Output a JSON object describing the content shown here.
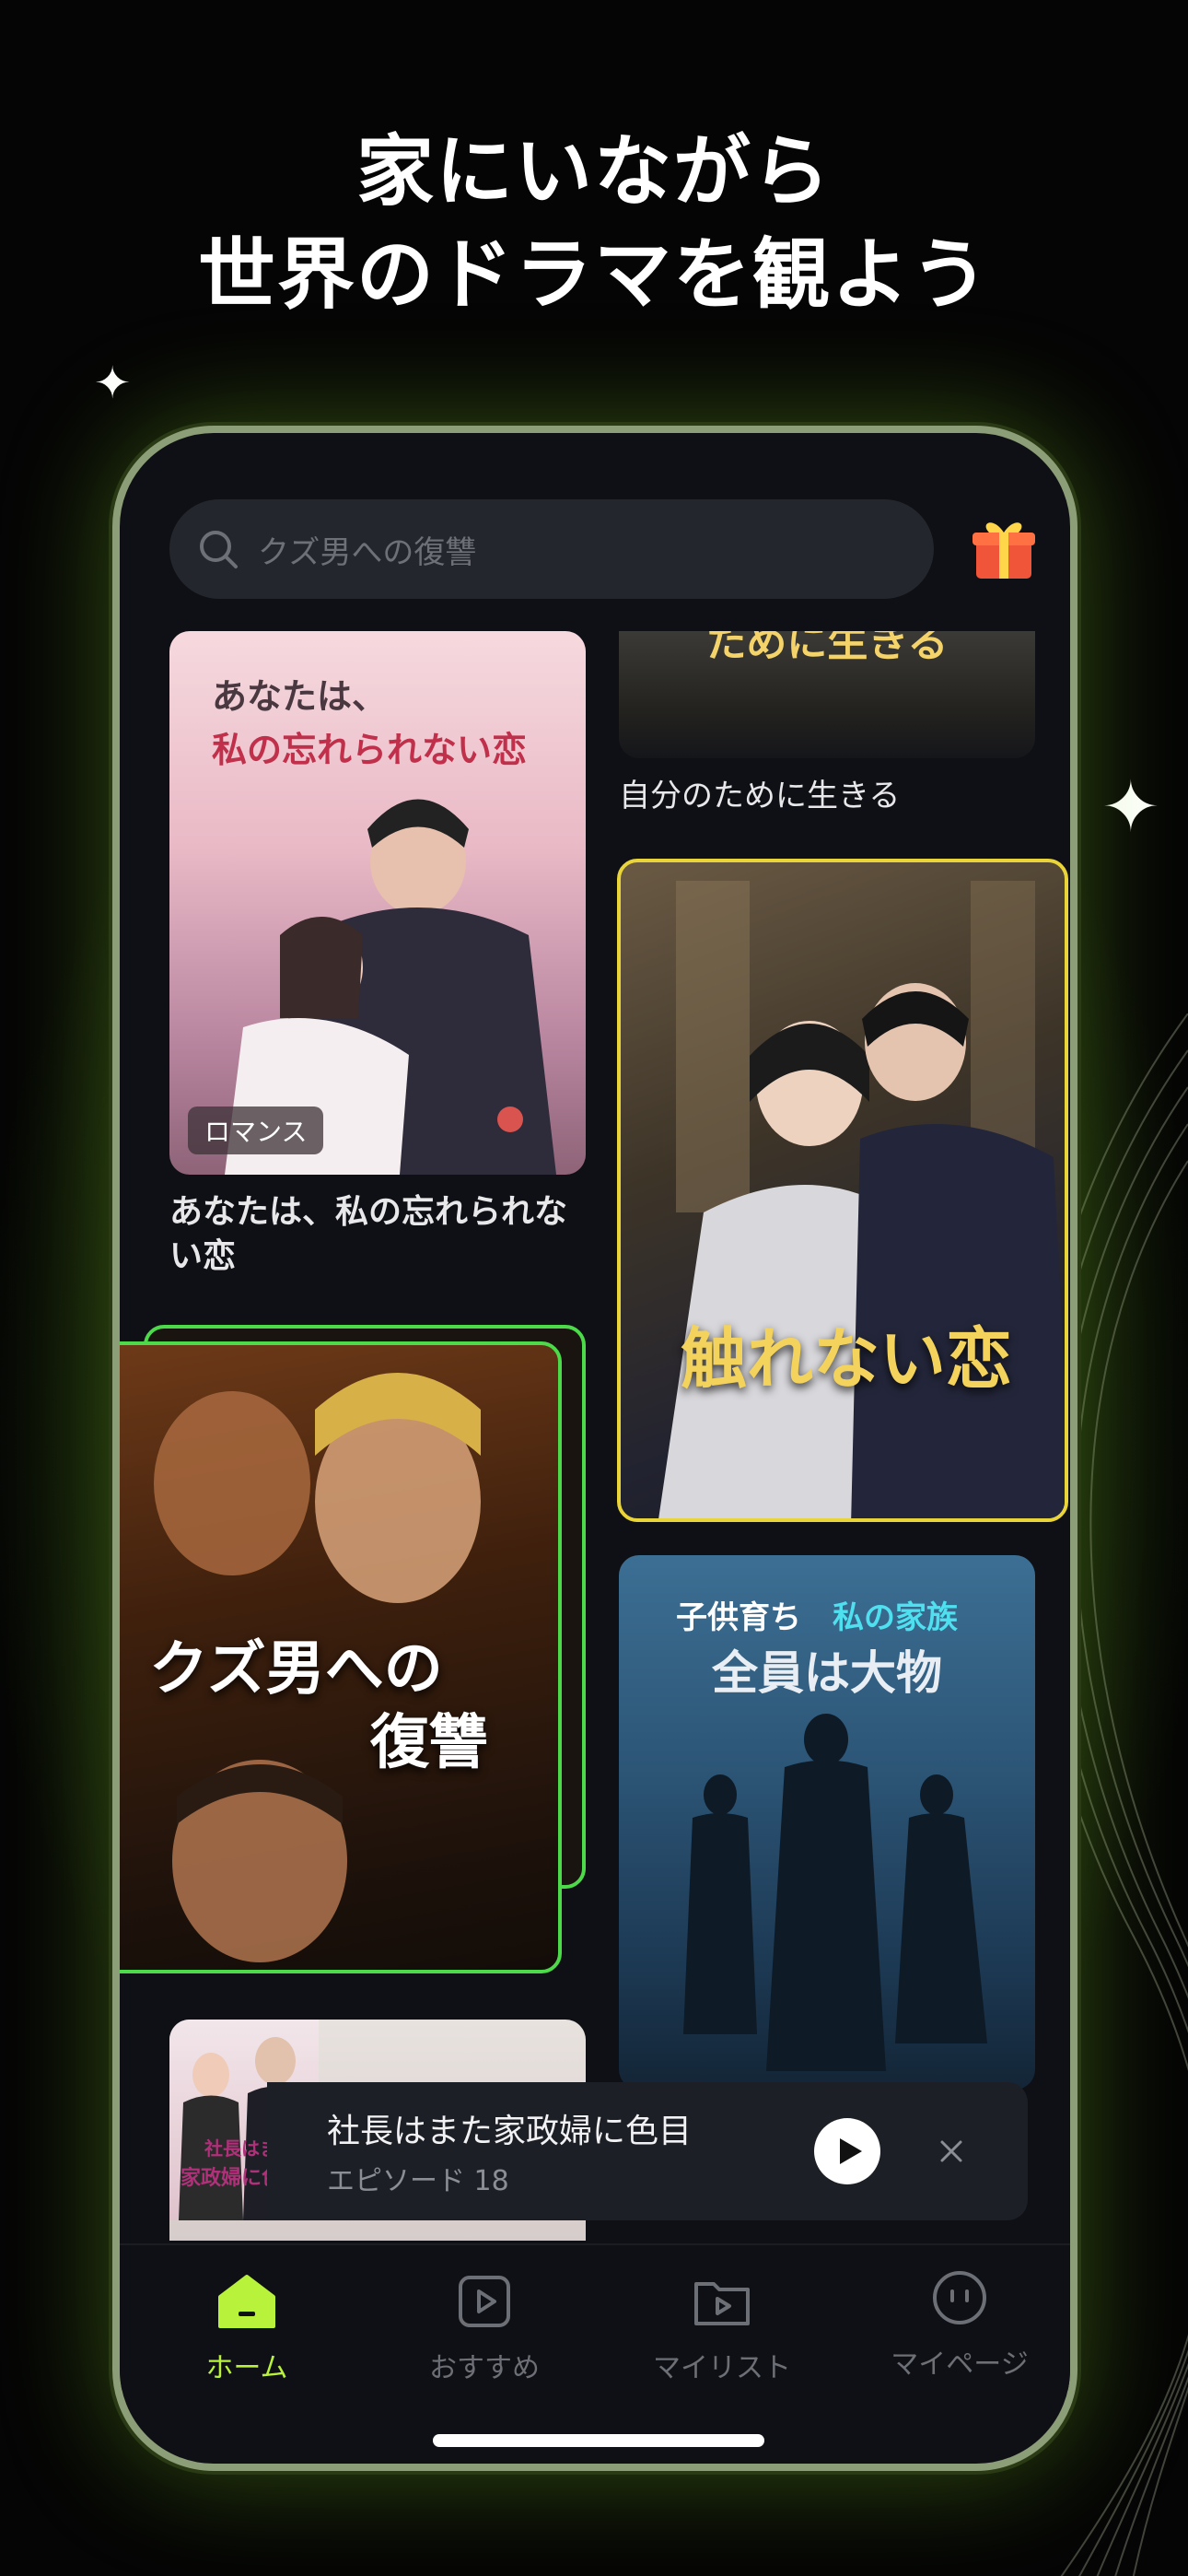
{
  "headline": {
    "line1": "家にいながら",
    "line2": "世界のドラマを観よう"
  },
  "search": {
    "placeholder": "クズ男への復讐"
  },
  "cards": {
    "romance": {
      "poster_line1": "あなたは、",
      "poster_line2": "私の忘れられない恋",
      "tag": "ロマンス",
      "title": "あなたは、私の忘れられない恋"
    },
    "top_right": {
      "poster_text": "ために生きる",
      "title": "自分のために生きる"
    },
    "featured": {
      "poster_text": "触れない恋"
    },
    "revenge": {
      "poster_line1": "クズ男への",
      "poster_line2": "復讐"
    },
    "family": {
      "poster_line1a": "子供育ち",
      "poster_line1b": "私の家族",
      "poster_line2": "全員は大物"
    }
  },
  "mini_player": {
    "thumb_line1": "社長はまた",
    "thumb_line2": "家政婦に色目",
    "title": "社長はまた家政婦に色目",
    "episode": "エピソード 18"
  },
  "tabs": [
    {
      "label": "ホーム",
      "icon": "home-icon",
      "active": true
    },
    {
      "label": "おすすめ",
      "icon": "play-square-icon",
      "active": false
    },
    {
      "label": "マイリスト",
      "icon": "folder-play-icon",
      "active": false
    },
    {
      "label": "マイページ",
      "icon": "face-icon",
      "active": false
    }
  ],
  "colors": {
    "accent": "#b8f23a",
    "featured_border": "#e9d43a",
    "revenge_border": "#4cd94a"
  }
}
